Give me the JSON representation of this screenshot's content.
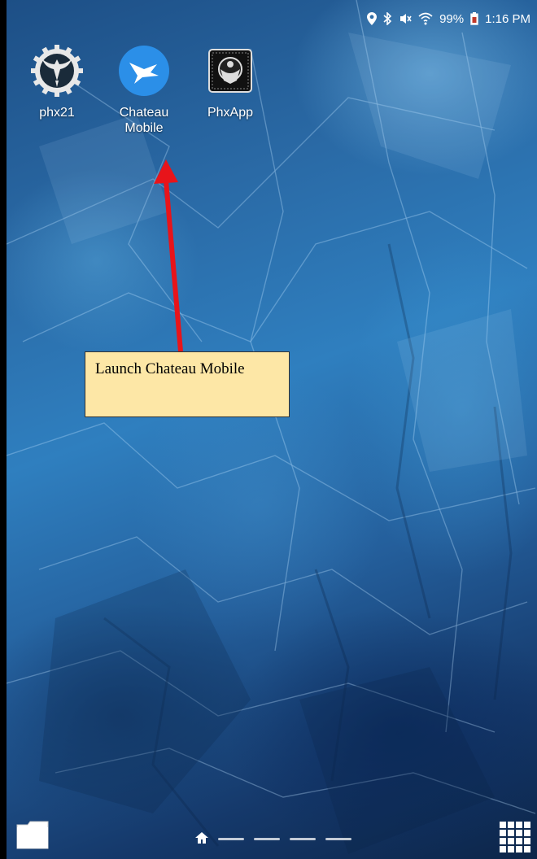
{
  "status_bar": {
    "battery": "99%",
    "time": "1:16 PM",
    "icons": [
      "location-icon",
      "bluetooth-icon",
      "mute-icon",
      "wifi-icon",
      "battery-icon"
    ]
  },
  "apps": [
    {
      "label": "phx21",
      "icon": "phx21-gear-bird-icon"
    },
    {
      "label": "Chateau\nMobile",
      "icon": "chateau-mobile-bird-icon"
    },
    {
      "label": "PhxApp",
      "icon": "phxapp-icon"
    }
  ],
  "annotation": {
    "text": "Launch Chateau Mobile",
    "box_color": "#fde7a6",
    "arrow_color": "#e8141a"
  },
  "dock": {
    "left_icon": "folder-icon",
    "home_icon": "home-icon",
    "page_count": 4,
    "right_icon": "app-drawer-grid-icon"
  }
}
